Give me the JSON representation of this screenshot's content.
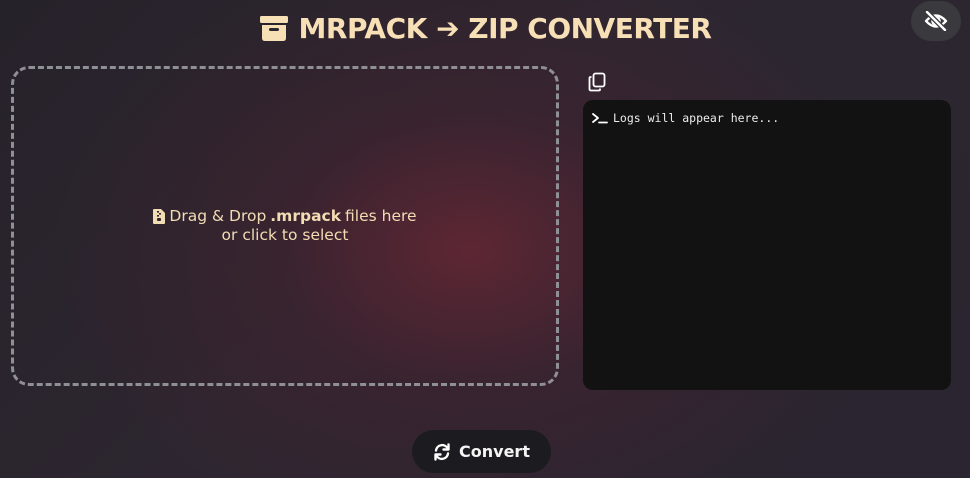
{
  "header": {
    "title": "MRPACK ➔ ZIP CONVERTER",
    "icon": "archive-icon"
  },
  "topbar": {
    "toggle_visibility_icon": "eye-slash-icon"
  },
  "dropzone": {
    "icon": "file-zipper-icon",
    "text_before": "Drag & Drop",
    "text_bold": ".mrpack",
    "text_after": "files here",
    "line2": "or click to select"
  },
  "logs": {
    "copy_icon": "copy-icon",
    "prompt_icon": "terminal-icon",
    "placeholder": "Logs will appear here..."
  },
  "actions": {
    "convert_label": "Convert",
    "convert_icon": "rotate-icon"
  },
  "colors": {
    "accent_text": "#f7dfb6",
    "log_bg": "#121212",
    "button_bg": "#1c1c20"
  }
}
